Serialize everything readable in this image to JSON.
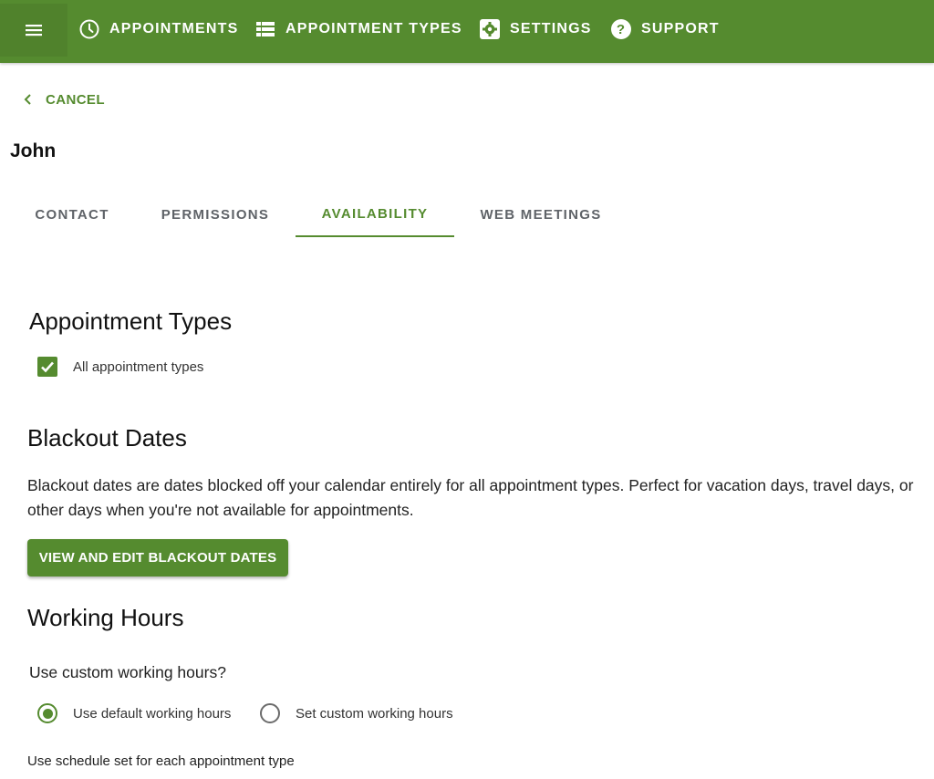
{
  "nav": {
    "items": [
      {
        "label": "APPOINTMENTS",
        "icon": "clock-icon"
      },
      {
        "label": "APPOINTMENT TYPES",
        "icon": "list-icon"
      },
      {
        "label": "SETTINGS",
        "icon": "gear-icon"
      },
      {
        "label": "SUPPORT",
        "icon": "help-icon"
      }
    ]
  },
  "cancel_label": "CANCEL",
  "user_name": "John",
  "tabs": [
    {
      "label": "CONTACT",
      "active": false
    },
    {
      "label": "PERMISSIONS",
      "active": false
    },
    {
      "label": "AVAILABILITY",
      "active": true
    },
    {
      "label": "WEB MEETINGS",
      "active": false
    }
  ],
  "appointment_types": {
    "heading": "Appointment Types",
    "checkbox_label": "All appointment types",
    "checked": true
  },
  "blackout": {
    "heading": "Blackout Dates",
    "description": "Blackout dates are dates blocked off your calendar entirely for all appointment types. Perfect for vacation days, travel days, or other days when you're not available for appointments.",
    "button_label": "VIEW AND EDIT BLACKOUT DATES"
  },
  "working_hours": {
    "heading": "Working Hours",
    "question": "Use custom working hours?",
    "options": [
      {
        "label": "Use default working hours",
        "selected": true
      },
      {
        "label": "Set custom working hours",
        "selected": false
      }
    ],
    "footnote": "Use schedule set for each appointment type"
  },
  "colors": {
    "accent": "#558b2f",
    "text": "#202124"
  }
}
